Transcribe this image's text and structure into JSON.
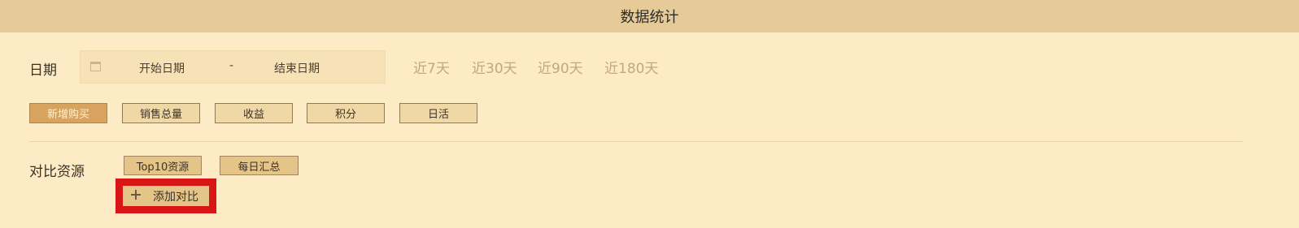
{
  "header": {
    "title": "数据统计"
  },
  "date": {
    "label": "日期",
    "icon": "calendar-icon",
    "start_placeholder": "开始日期",
    "separator": "-",
    "end_placeholder": "结束日期"
  },
  "quick_ranges": [
    "近7天",
    "近30天",
    "近90天",
    "近180天"
  ],
  "metrics": {
    "items": [
      "新增购买",
      "销售总量",
      "收益",
      "积分",
      "日活"
    ],
    "active_index": 0,
    "active_color": "#d7a35f"
  },
  "compare": {
    "label": "对比资源",
    "items": [
      "Top10资源",
      "每日汇总"
    ],
    "add_label": "添加对比",
    "add_icon": "plus-icon",
    "highlight_color": "#d81616"
  }
}
